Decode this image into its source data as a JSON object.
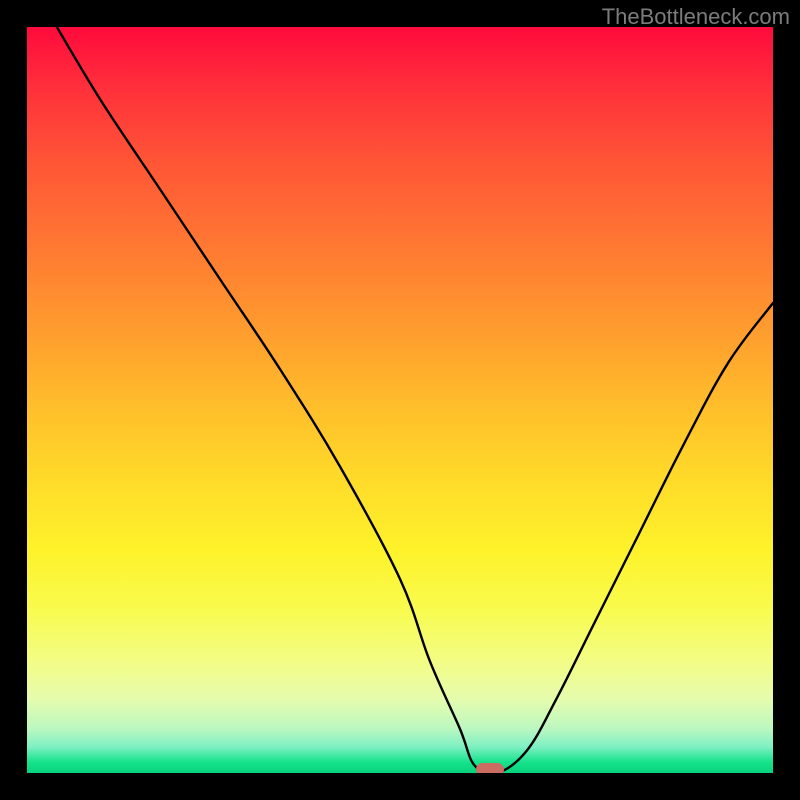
{
  "attribution": "TheBottleneck.com",
  "chart_data": {
    "type": "line",
    "title": "",
    "xlabel": "",
    "ylabel": "",
    "xlim": [
      0,
      100
    ],
    "ylim": [
      0,
      100
    ],
    "background_gradient": {
      "top": "#ff0a3c",
      "bottom": "#06d37b",
      "description": "vertical rainbow gradient: red→orange→yellow→green"
    },
    "series": [
      {
        "name": "bottleneck-curve",
        "color": "#000000",
        "x": [
          4,
          10,
          18,
          26,
          34,
          42,
          50,
          54,
          58,
          60,
          63,
          67,
          71,
          76,
          82,
          88,
          94,
          100
        ],
        "y": [
          100,
          90,
          78,
          66,
          54,
          41,
          26,
          15,
          6,
          1,
          0,
          3,
          10,
          20,
          32,
          44,
          55,
          63
        ]
      }
    ],
    "marker": {
      "name": "optimal-point",
      "x": 62,
      "y": 0.5,
      "color": "#cb6b62"
    }
  },
  "layout": {
    "image_size": 800,
    "plot_margin": 27
  }
}
